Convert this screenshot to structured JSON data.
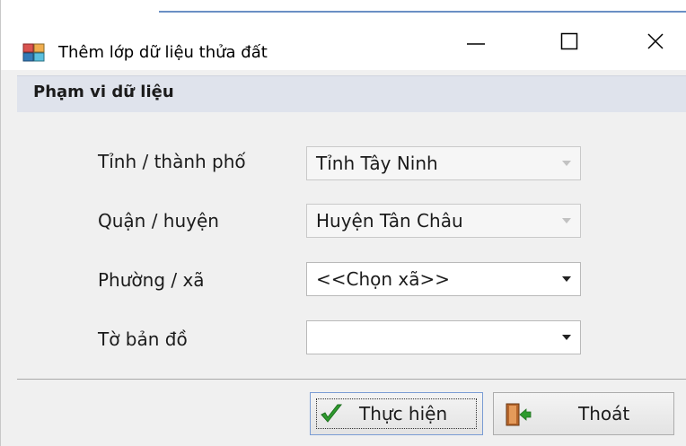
{
  "window": {
    "title": "Thêm lớp dữ liệu thửa đất",
    "controls": {
      "minimize": "—",
      "maximize": "☐",
      "close": "✕"
    }
  },
  "section": {
    "title": "Phạm vi dữ liệu"
  },
  "fields": [
    {
      "label": "Tỉnh / thành phố",
      "value": "Tỉnh Tây Ninh",
      "enabled": false
    },
    {
      "label": "Quận / huyện",
      "value": "Huyện Tân Châu",
      "enabled": false
    },
    {
      "label": "Phường / xã",
      "value": "<<Chọn xã>>",
      "enabled": true
    },
    {
      "label": "Tờ bản đồ",
      "value": "",
      "enabled": true
    }
  ],
  "buttons": {
    "ok_label": "Thực hiện",
    "exit_label": "Thoát"
  },
  "icons": {
    "app": "window-app-icon",
    "ok": "green-check-icon",
    "exit": "exit-door-icon"
  },
  "colors": {
    "section_header": "#dfe3ec",
    "check_green": "#2e9b2e",
    "focus_border": "#7a9cd4"
  }
}
